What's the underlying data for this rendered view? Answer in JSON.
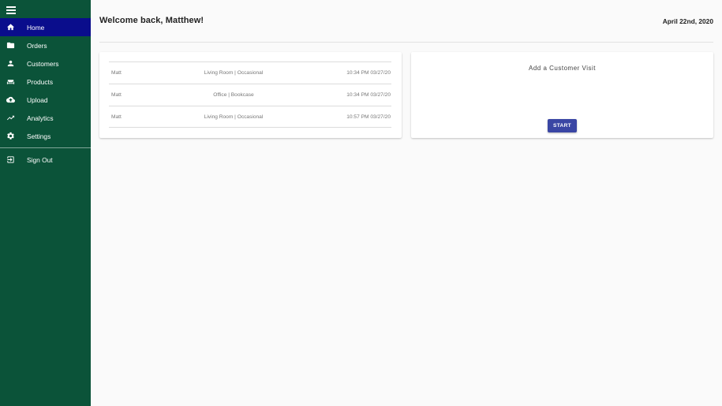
{
  "sidebar": {
    "menu_icon": "hamburger-icon",
    "items": [
      {
        "label": "Home",
        "icon": "home-icon",
        "active": true
      },
      {
        "label": "Orders",
        "icon": "folder-icon",
        "active": false
      },
      {
        "label": "Customers",
        "icon": "person-icon",
        "active": false
      },
      {
        "label": "Products",
        "icon": "sofa-icon",
        "active": false
      },
      {
        "label": "Upload",
        "icon": "cloud-upload-icon",
        "active": false
      },
      {
        "label": "Analytics",
        "icon": "trending-icon",
        "active": false
      },
      {
        "label": "Settings",
        "icon": "gear-icon",
        "active": false
      }
    ],
    "signout": {
      "label": "Sign Out",
      "icon": "sign-out-icon"
    }
  },
  "header": {
    "title": "Welcome back, Matthew!",
    "date": "April 22nd, 2020"
  },
  "visits": {
    "rows": [
      {
        "name": "Matt",
        "room": "Living Room | Occasional",
        "time": "10:34 PM 03/27/20"
      },
      {
        "name": "Matt",
        "room": "Office | Bookcase",
        "time": "10:34 PM 03/27/20"
      },
      {
        "name": "Matt",
        "room": "Living Room | Occasional",
        "time": "10:57 PM 03/27/20"
      }
    ]
  },
  "add_visit": {
    "title": "Add a Customer Visit",
    "button_label": "START"
  },
  "colors": {
    "sidebar_bg": "#0b5339",
    "active_bg": "#0a0d8c",
    "button_bg": "#3a46a4"
  }
}
